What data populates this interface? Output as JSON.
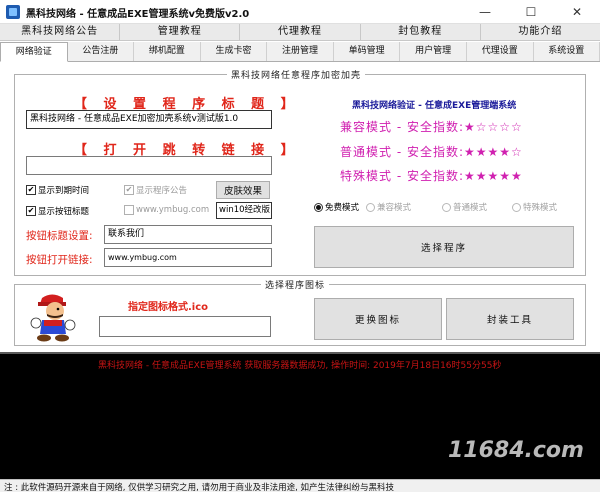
{
  "window": {
    "title": "黑科技网络 - 任意成品EXE管理系统v免费版v2.0",
    "minimize_glyph": "—",
    "maximize_glyph": "☐",
    "close_glyph": "✕"
  },
  "menu": [
    "黑科技网络公告",
    "管理教程",
    "代理教程",
    "封包教程",
    "功能介绍"
  ],
  "tabs": [
    "网络验证",
    "公告注册",
    "绑机配置",
    "生成卡密",
    "注册管理",
    "单码管理",
    "用户管理",
    "代理设置",
    "系统设置"
  ],
  "active_tab": "网络验证",
  "encrypt_group": {
    "legend": "黑科技网络任意程序加密加壳",
    "title_heading": "【 设 置 程 序 标 题 】",
    "title_value": "黑科技网络 - 任意成品EXE加密加壳系统v测试版1.0",
    "link_heading": "【 打 开 跳 转 链 接 】",
    "link_value": "",
    "chk_expire": {
      "label": "显示到期时间",
      "checked": true
    },
    "chk_notice": {
      "label": "显示程序公告",
      "checked": true,
      "disabled": true
    },
    "skin_button": "皮肤效果",
    "chk_button_title": {
      "label": "显示按钮标题",
      "checked": true
    },
    "chk_site": {
      "label": "www.ymbug.com",
      "checked": false,
      "disabled": true
    },
    "skin_value": "win10经改版",
    "btn_title_label": "按钮标题设置:",
    "btn_title_value": "联系我们",
    "btn_link_label": "按钮打开链接:",
    "btn_link_value": "www.ymbug.com",
    "side_title": "黑科技网络验证 - 任意成EXE管理端系统",
    "modes": [
      {
        "text": "兼容模式 - 安全指数:",
        "stars": "★☆☆☆☆"
      },
      {
        "text": "普通模式 - 安全指数:",
        "stars": "★★★★☆"
      },
      {
        "text": "特殊模式 - 安全指数:",
        "stars": "★★★★★"
      }
    ],
    "radios": [
      {
        "label": "免费模式",
        "selected": true,
        "disabled": false
      },
      {
        "label": "兼容模式",
        "selected": false,
        "disabled": true
      },
      {
        "label": "普通模式",
        "selected": false,
        "disabled": true
      },
      {
        "label": "特殊模式",
        "selected": false,
        "disabled": true
      }
    ],
    "select_button": "选择程序"
  },
  "icon_group": {
    "legend": "选择程序图标",
    "format_label": "指定图标格式.ico",
    "path_value": "",
    "change_button": "更换图标",
    "pack_button": "封装工具"
  },
  "log": {
    "line": "黑科技网络 - 任意成品EXE管理系统 获取服务器数据成功, 操作时间: 2019年7月18日16时55分55秒"
  },
  "status": {
    "text": "注 : 此软件源码开源来自于网络, 仅供学习研究之用, 请勿用于商业及非法用途, 如产生法律纠纷与黑科技"
  },
  "watermark": "11684.com",
  "colors": {
    "accent_red": "#e0261a",
    "mode_magenta": "#d020b0",
    "title_blue": "#1a1a9a"
  }
}
